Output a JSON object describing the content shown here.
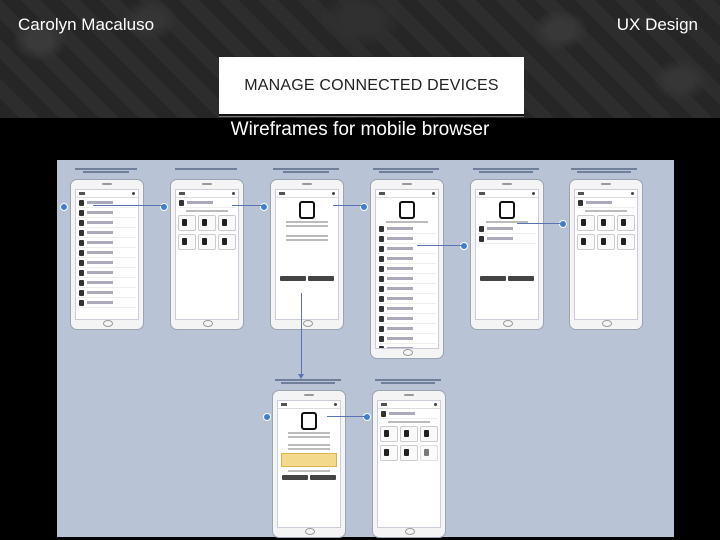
{
  "header": {
    "author": "Carolyn Macaluso",
    "topic": "UX Design",
    "title": "MANAGE CONNECTED DEVICES",
    "subtitle": "Wireframes for mobile browser"
  },
  "screens": [
    {
      "id": "s1"
    },
    {
      "id": "s2"
    },
    {
      "id": "s3"
    },
    {
      "id": "s4"
    },
    {
      "id": "s5"
    },
    {
      "id": "s6"
    },
    {
      "id": "s7"
    },
    {
      "id": "s8"
    }
  ],
  "colors": {
    "canvas": "#b8c4d6",
    "connector": "#5a73b3",
    "hotspot": "#3f7fd0",
    "highlight_note": "#f3d98b"
  }
}
